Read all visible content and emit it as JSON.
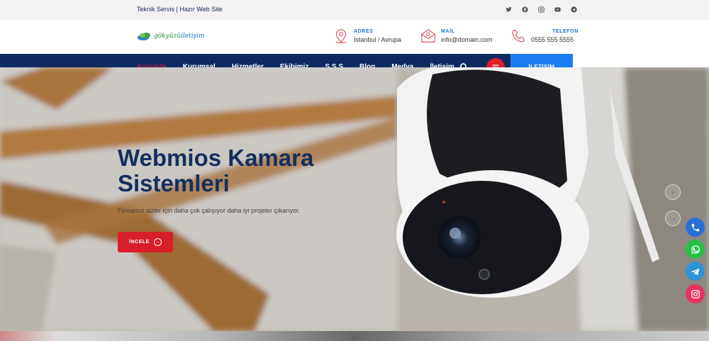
{
  "topbar": {
    "tagline": "Teknik Servis | Hazır Web Site",
    "socials": [
      "twitter-icon",
      "facebook-icon",
      "instagram-icon",
      "youtube-icon",
      "telegram-icon"
    ]
  },
  "header": {
    "logo": {
      "part1": "gökyüzü",
      "part2": "iletişim"
    },
    "address": {
      "label": "ADRES",
      "value": "İstanbul / Avrupa"
    },
    "mail": {
      "label": "MAİL",
      "value": "info@domain.com"
    },
    "phone": {
      "label": "TELEFON",
      "value": "0555 555 5555"
    }
  },
  "nav": {
    "items": [
      "Anasayfa",
      "Kurumsal",
      "Hizmetler",
      "Ekibimiz",
      "S.S.S",
      "Blog",
      "Medya",
      "İletişim"
    ],
    "cta": "İLETİŞİM"
  },
  "hero": {
    "title": "Webmios Kamara Sistemleri",
    "subtitle": "Firmamız sizler için daha çok çalışıyor daha iyi projeler çıkarıyor.",
    "button": "İNCELE"
  },
  "colors": {
    "navy": "#0f2a5f",
    "red": "#e11d2a",
    "blue": "#1a7df0",
    "title": "#142f5e"
  },
  "floating": [
    "phone-icon",
    "whatsapp-icon",
    "telegram-icon",
    "instagram-icon"
  ]
}
